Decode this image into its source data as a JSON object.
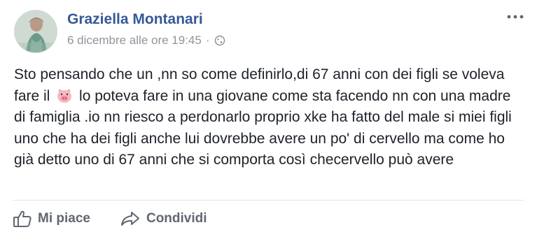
{
  "post": {
    "author_name": "Graziella Montanari",
    "timestamp": "6 dicembre alle ore 19:45",
    "separator": "·",
    "privacy_icon": "globe-icon",
    "more_icon": "more-options-icon",
    "text_before_emoji": "Sto pensando che un ,nn so come definirlo,di 67 anni con dei figli se voleva fare il ",
    "emoji": "pig-face-icon",
    "text_after_emoji": " lo poteva fare in una giovane come sta facendo nn con una madre di famiglia .io nn riesco a perdonarlo proprio xke ha fatto del male si miei figli uno che ha dei figli anche lui dovrebbe avere un po' di cervello ma come ho già detto uno di 67 anni che si comporta così checervello può avere"
  },
  "actions": {
    "like_label": "Mi piace",
    "like_icon": "thumbs-up-icon",
    "share_label": "Condividi",
    "share_icon": "share-arrow-icon"
  },
  "colors": {
    "author_link": "#365899",
    "meta_text": "#90949c",
    "action_text": "#606770",
    "body_text": "#1d2129"
  }
}
